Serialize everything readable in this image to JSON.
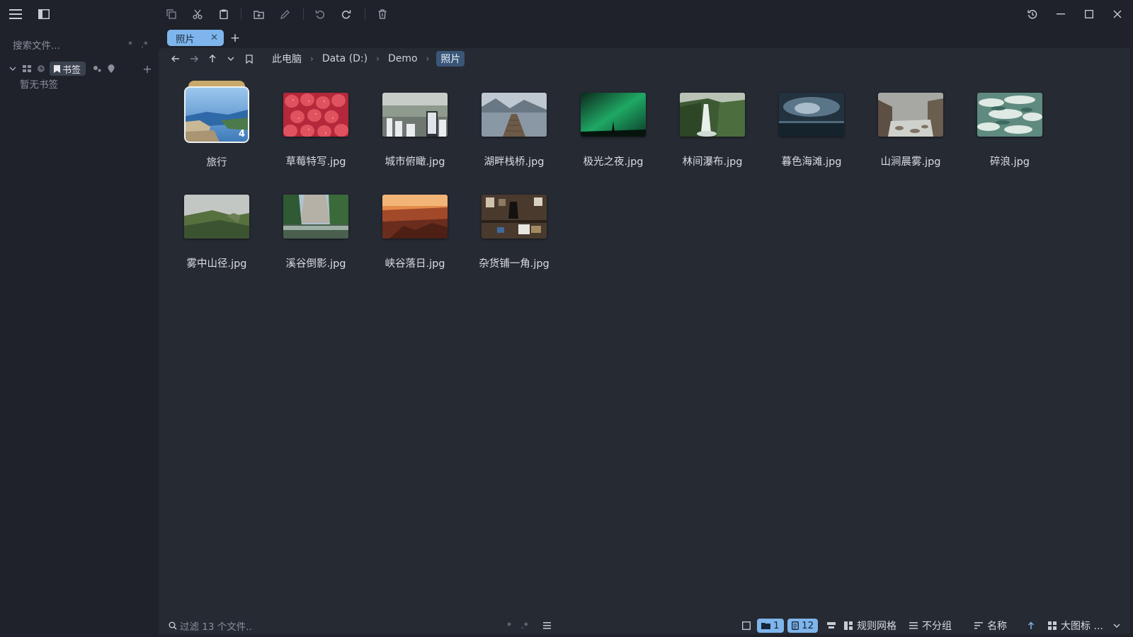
{
  "toolbar": {
    "icons": [
      "menu-icon",
      "sidebar-toggle-icon",
      "copy-icon",
      "cut-icon",
      "paste-icon",
      "new-folder-icon",
      "rename-icon",
      "undo-icon",
      "redo-icon",
      "delete-icon",
      "history-icon",
      "minimize-icon",
      "maximize-icon",
      "close-icon"
    ]
  },
  "sidebar": {
    "search_placeholder": "搜索文件...",
    "search_opt1": "*",
    "search_opt2": ".*",
    "bookmark_label": "书签",
    "add_label": "+",
    "empty_text": "暂无书签"
  },
  "tabs": [
    {
      "label": "照片",
      "close": "✕"
    }
  ],
  "new_tab_label": "+",
  "breadcrumb": [
    "此电脑",
    "Data (D:)",
    "Demo",
    "照片"
  ],
  "items": [
    {
      "name": "旅行",
      "type": "folder",
      "count": "4"
    },
    {
      "name": "草莓特写.jpg",
      "type": "image"
    },
    {
      "name": "城市俯瞰.jpg",
      "type": "image"
    },
    {
      "name": "湖畔栈桥.jpg",
      "type": "image"
    },
    {
      "name": "极光之夜.jpg",
      "type": "image"
    },
    {
      "name": "林间瀑布.jpg",
      "type": "image"
    },
    {
      "name": "暮色海滩.jpg",
      "type": "image"
    },
    {
      "name": "山涧晨雾.jpg",
      "type": "image"
    },
    {
      "name": "碎浪.jpg",
      "type": "image"
    },
    {
      "name": "雾中山径.jpg",
      "type": "image"
    },
    {
      "name": "溪谷倒影.jpg",
      "type": "image"
    },
    {
      "name": "峡谷落日.jpg",
      "type": "image"
    },
    {
      "name": "杂货铺一角.jpg",
      "type": "image"
    }
  ],
  "statusbar": {
    "filter_placeholder": "过滤 13 个文件..",
    "filter_opt1": "*",
    "filter_opt2": ".*",
    "folders_count": "1",
    "files_count": "12",
    "layout_label": "规则网格",
    "group_label": "不分组",
    "sort_label": "名称",
    "view_label": "大图标 ..."
  },
  "colors": {
    "accent": "#7eb5ec",
    "background": "#1f222a",
    "content_bg": "#262a33"
  }
}
